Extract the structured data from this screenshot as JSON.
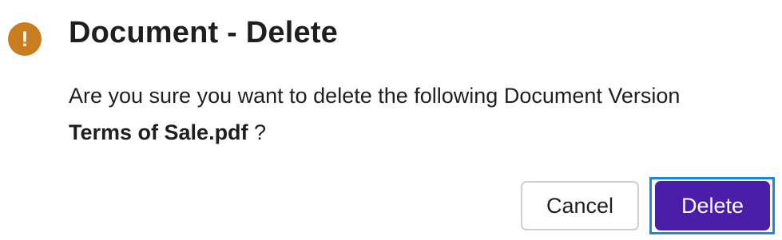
{
  "dialog": {
    "icon": "exclamation-icon",
    "icon_glyph": "!",
    "icon_color": "#c97d1f",
    "title": "Document - Delete",
    "message_line1": "Are you sure you want to delete the following Document Version",
    "document_name": "Terms of Sale.pdf",
    "message_suffix": " ?",
    "buttons": {
      "cancel_label": "Cancel",
      "delete_label": "Delete"
    },
    "colors": {
      "primary": "#4a1ea8",
      "focus_ring": "#1a86e8"
    }
  }
}
